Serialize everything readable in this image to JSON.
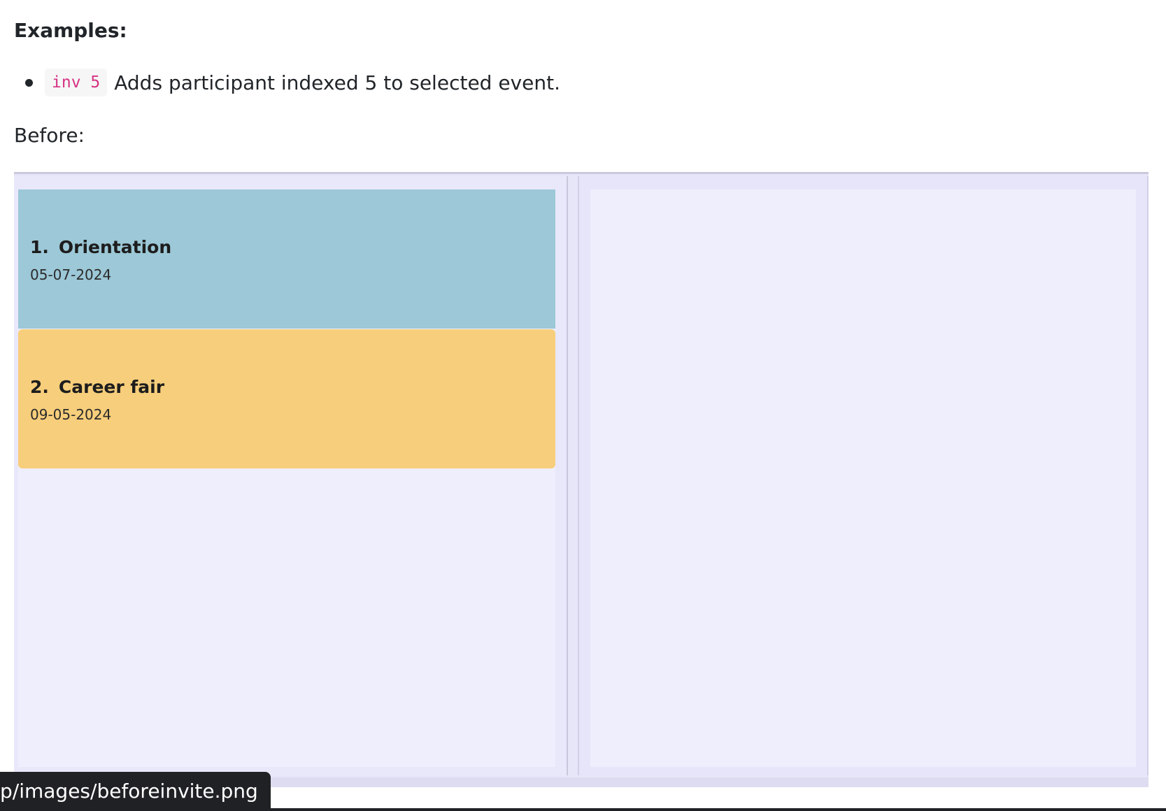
{
  "examples": {
    "heading": "Examples:",
    "items": [
      {
        "code": "inv 5",
        "description": "Adds participant indexed 5 to selected event."
      }
    ]
  },
  "before": {
    "label": "Before:"
  },
  "app_screenshot": {
    "events": [
      {
        "index": "1.",
        "name": "Orientation",
        "date": "05-07-2024",
        "color": "#9cc8d7"
      },
      {
        "index": "2.",
        "name": "Career fair",
        "date": "09-05-2024",
        "color": "#f7ce7b"
      }
    ]
  },
  "status_tooltip": {
    "url_text": "p/images/beforeinvite.png"
  }
}
